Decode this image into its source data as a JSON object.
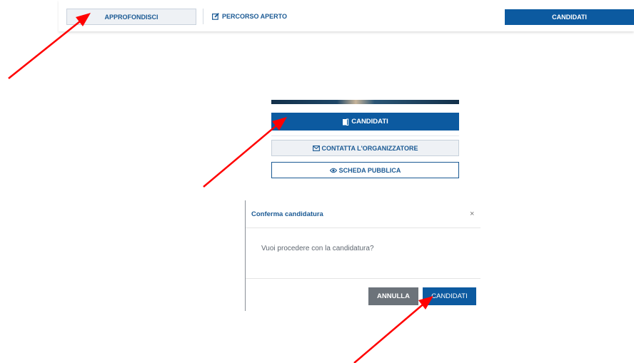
{
  "topbar": {
    "approfondisci_label": "APPROFONDISCI",
    "percorso_label": "PERCORSO APERTO",
    "candidati_label": "CANDIDATI"
  },
  "card": {
    "candidati_label": "CANDIDATI",
    "contatta_label": "CONTATTA L'ORGANIZZATORE",
    "scheda_label": "SCHEDA PUBBLICA"
  },
  "modal": {
    "title": "Conferma candidatura",
    "close_symbol": "×",
    "message": "Vuoi procedere con la candidatura?",
    "cancel_label": "ANNULLA",
    "confirm_label": "CANDIDATI"
  },
  "icons": {
    "percorso": "edit-icon",
    "candidati": "door-icon",
    "contatta": "envelope-icon",
    "scheda": "eye-icon"
  },
  "colors": {
    "primary": "#0c5aa0",
    "link": "#1b5a94",
    "secondary_button": "#6c737a",
    "arrow": "#ff0000"
  }
}
